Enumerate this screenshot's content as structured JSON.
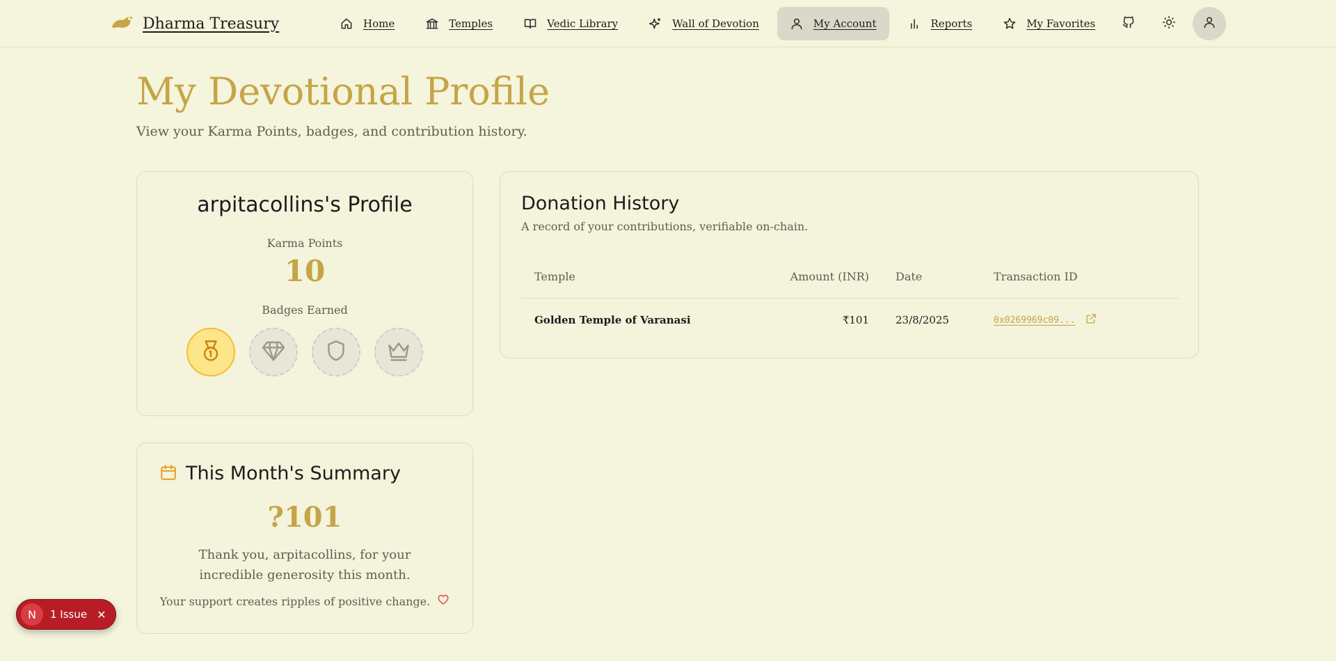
{
  "nav": {
    "brand": "Dharma Treasury",
    "items": [
      {
        "label": "Home",
        "icon": "home-icon",
        "active": false
      },
      {
        "label": "Temples",
        "icon": "temple-icon",
        "active": false
      },
      {
        "label": "Vedic Library",
        "icon": "book-icon",
        "active": false
      },
      {
        "label": "Wall of Devotion",
        "icon": "sparkles-icon",
        "active": false
      },
      {
        "label": "My Account",
        "icon": "user-icon",
        "active": true
      },
      {
        "label": "Reports",
        "icon": "bar-chart-icon",
        "active": false
      },
      {
        "label": "My Favorites",
        "icon": "star-icon",
        "active": false
      }
    ],
    "actions": [
      "github-icon",
      "sun-icon",
      "user-icon"
    ]
  },
  "header": {
    "title": "My Devotional Profile",
    "subtitle": "View your Karma Points, badges, and contribution history."
  },
  "profile": {
    "name": "arpitacollins's Profile",
    "karma_label": "Karma Points",
    "karma_value": "10",
    "badges_label": "Badges Earned",
    "badges": [
      {
        "icon": "medal-icon",
        "earned": true
      },
      {
        "icon": "diamond-icon",
        "earned": false
      },
      {
        "icon": "shield-icon",
        "earned": false
      },
      {
        "icon": "crown-icon",
        "earned": false
      }
    ]
  },
  "summary": {
    "title": "This Month's Summary",
    "amount": "?101",
    "thanks": "Thank you, arpitacollins, for your incredible generosity this month.",
    "note": "Your support creates ripples of positive change."
  },
  "history": {
    "title": "Donation History",
    "description": "A record of your contributions, verifiable on-chain.",
    "columns": {
      "temple": "Temple",
      "amount": "Amount (INR)",
      "date": "Date",
      "tx": "Transaction ID"
    },
    "rows": [
      {
        "temple": "Golden Temple of Varanasi",
        "amount": "₹101",
        "date": "23/8/2025",
        "tx": "0x0269969c09..."
      }
    ]
  },
  "issue_badge": {
    "logo": "N",
    "label": "1 Issue"
  },
  "colors": {
    "accent": "#c4a547",
    "background": "#f5f4dc",
    "badge_earned": "#fde58a",
    "issue": "#b81d25"
  }
}
